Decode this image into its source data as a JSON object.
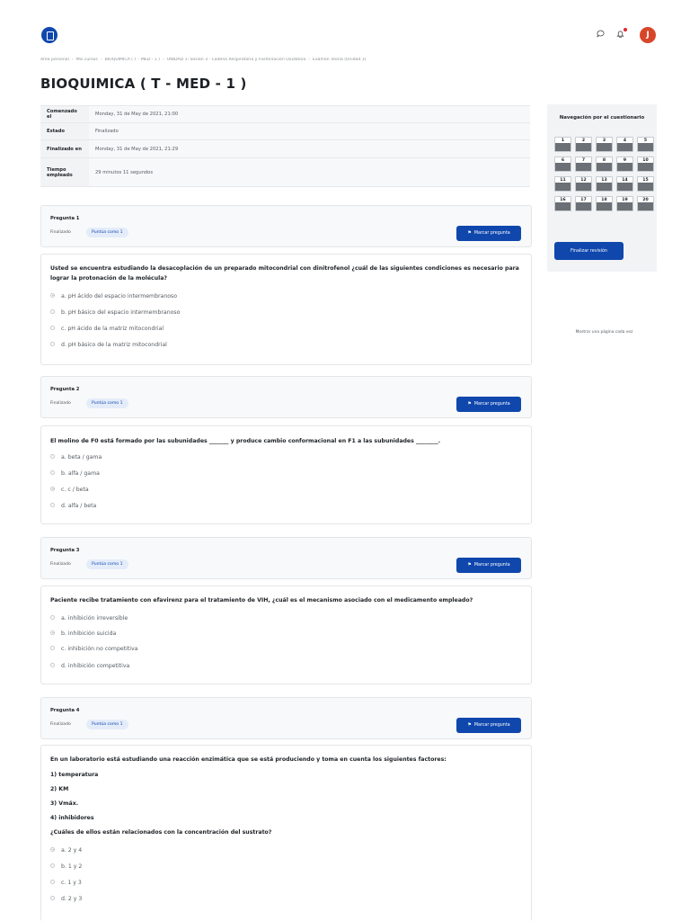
{
  "header": {
    "logo_icon": "moodle-logo-icon",
    "chat_icon": "chat-bubble-icon",
    "bell_icon": "bell-icon",
    "avatar_initial": "J"
  },
  "breadcrumb": [
    "Área personal",
    "Mis cursos",
    "BIOQUIMICA ( T - MED - 1 )",
    "UNIDAD 1: Sesión 3 - Cadena Respiratoria y Fosforilación Oxidativa",
    "Examen Teoría (Unidad 1)"
  ],
  "page_title": "BIOQUIMICA ( T - MED - 1 )",
  "summary": [
    {
      "label": "Comenzado el",
      "value": "Monday, 31 de May de 2021, 21:00"
    },
    {
      "label": "Estado",
      "value": "Finalizado"
    },
    {
      "label": "Finalizado en",
      "value": "Monday, 31 de May de 2021, 21:29"
    },
    {
      "label": "Tiempo empleado",
      "value": "29 minutos 11 segundos"
    }
  ],
  "questions": [
    {
      "number_label": "Pregunta 1",
      "state": "Finalizado",
      "grade": "Puntúa como 1",
      "flag_label": "Marcar pregunta",
      "text": "Usted se encuentra estudiando la desacoplación de un preparado mitocondrial con dinitrofenol ¿cuál de las siguientes condiciones es necesario para lograr la protonación de la molécula?",
      "answers": [
        {
          "label": "a. pH ácido del espacio intermembranoso",
          "checked": true
        },
        {
          "label": "b. pH básico del espacio intermembranoso",
          "checked": false
        },
        {
          "label": "c. pH ácido de la matriz mitocondrial",
          "checked": false
        },
        {
          "label": "d. pH básico de la matriz mitocondrial",
          "checked": false
        }
      ]
    },
    {
      "number_label": "Pregunta 2",
      "state": "Finalizado",
      "grade": "Puntúa como 1",
      "flag_label": "Marcar pregunta",
      "text": "El molino de F0 está formado por las subunidades _______ y produce cambio conformacional en F1 a las subunidades ________.",
      "answers": [
        {
          "label": "a. beta / gama",
          "checked": false
        },
        {
          "label": "b. alfa / gama",
          "checked": false
        },
        {
          "label": "c. c / beta",
          "checked": true
        },
        {
          "label": "d. alfa / beta",
          "checked": false
        }
      ]
    },
    {
      "number_label": "Pregunta 3",
      "state": "Finalizado",
      "grade": "Puntúa como 1",
      "flag_label": "Marcar pregunta",
      "text": "Paciente recibe tratamiento con efavirenz para el tratamiento de VIH, ¿cuál es el mecanismo asociado con el medicamento empleado?",
      "answers": [
        {
          "label": "a. inhibición irreversible",
          "checked": false
        },
        {
          "label": "b. inhibición suicida",
          "checked": true
        },
        {
          "label": "c. inhibición no competitiva",
          "checked": false
        },
        {
          "label": "d. inhibición competitiva",
          "checked": false
        }
      ]
    },
    {
      "number_label": "Pregunta 4",
      "state": "Finalizado",
      "grade": "Puntúa como 1",
      "flag_label": "Marcar pregunta",
      "text_lines": [
        "En un laboratorio está estudiando una reacción enzimática que se está produciendo y toma en cuenta los siguientes factores:",
        "1) temperatura",
        "2) KM",
        "3) Vmáx.",
        "4) inhibidores",
        "¿Cuáles de ellos están relacionados con la concentración del sustrato?"
      ],
      "answers": [
        {
          "label": "a. 2 y 4",
          "checked": true
        },
        {
          "label": "b. 1 y 2",
          "checked": false
        },
        {
          "label": "c. 1 y 3",
          "checked": false
        },
        {
          "label": "d. 2 y 3",
          "checked": false
        }
      ]
    }
  ],
  "nav": {
    "title": "Navegación por el cuestionario",
    "buttons": [
      "1",
      "2",
      "3",
      "4",
      "5",
      "6",
      "7",
      "8",
      "9",
      "10",
      "11",
      "12",
      "13",
      "14",
      "15",
      "16",
      "17",
      "18",
      "19",
      "20"
    ],
    "show_one_page": "Mostrar una página cada vez",
    "finish_review": "Finalizar revisión"
  }
}
